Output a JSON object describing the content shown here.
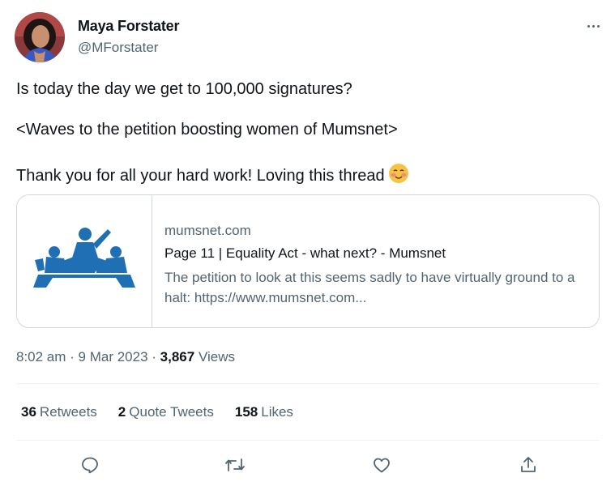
{
  "author": {
    "name": "Maya Forstater",
    "handle": "@MForstater"
  },
  "tweet": {
    "lines": [
      "Is today the day we get to 100,000 signatures?",
      "<Waves to the petition boosting women of Mumsnet>",
      "Thank you for all your hard work! Loving this thread"
    ],
    "emoji": "smiling-face-with-blushing-cheeks"
  },
  "card": {
    "domain": "mumsnet.com",
    "title": "Page 11 | Equality Act - what next? - Mumsnet",
    "description": "The petition to look at this seems sadly to have virtually ground to a halt: https://www.mumsnet.com...",
    "logo_color": "#1f6fb5"
  },
  "meta": {
    "time": "8:02 am",
    "sep1": " · ",
    "date": "9 Mar 2023",
    "sep2": " · ",
    "views_count": "3,867",
    "views_label": "Views"
  },
  "stats": {
    "retweets_count": "36",
    "retweets_label": "Retweets",
    "quotes_count": "2",
    "quotes_label": "Quote Tweets",
    "likes_count": "158",
    "likes_label": "Likes"
  },
  "actions": [
    "reply-icon",
    "retweet-icon",
    "like-icon",
    "share-icon"
  ],
  "colors": {
    "text": "#0f1419",
    "secondary": "#536471",
    "border": "#cfd9de"
  }
}
